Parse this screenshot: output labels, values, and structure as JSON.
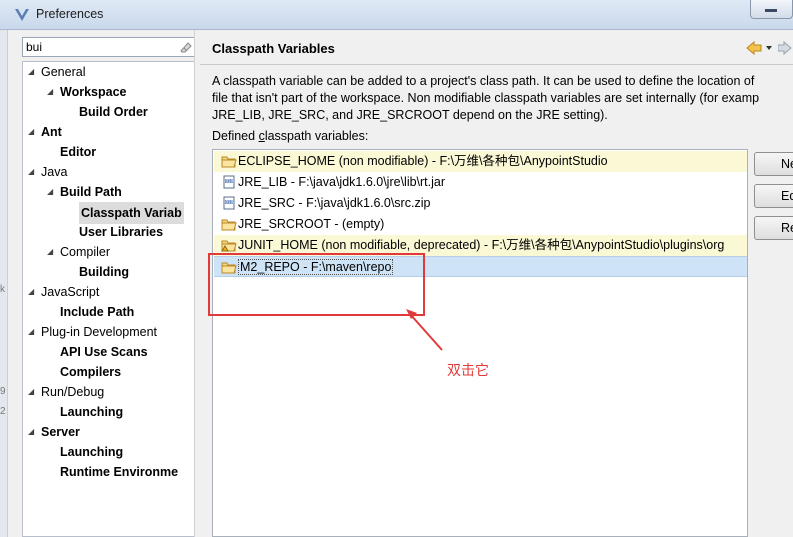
{
  "window": {
    "title": "Preferences"
  },
  "filter": {
    "value": "bui"
  },
  "tree": [
    {
      "label": "General",
      "level": 0,
      "expanded": true,
      "bold": false
    },
    {
      "label": "Workspace",
      "level": 1,
      "expanded": true,
      "bold": true
    },
    {
      "label": "Build Order",
      "level": 2,
      "bold": true
    },
    {
      "label": "Ant",
      "level": 0,
      "expanded": true,
      "bold": true
    },
    {
      "label": "Editor",
      "level": 1,
      "bold": true
    },
    {
      "label": "Java",
      "level": 0,
      "expanded": true,
      "bold": false
    },
    {
      "label": "Build Path",
      "level": 1,
      "expanded": true,
      "bold": true
    },
    {
      "label": "Classpath Variab",
      "level": 2,
      "bold": true,
      "selected": true
    },
    {
      "label": "User Libraries",
      "level": 2,
      "bold": true
    },
    {
      "label": "Compiler",
      "level": 1,
      "expanded": true,
      "bold": false
    },
    {
      "label": "Building",
      "level": 2,
      "bold": true
    },
    {
      "label": "JavaScript",
      "level": 0,
      "expanded": true,
      "bold": false
    },
    {
      "label": "Include Path",
      "level": 1,
      "bold": true
    },
    {
      "label": "Plug-in Development",
      "level": 0,
      "expanded": true,
      "bold": false
    },
    {
      "label": "API Use Scans",
      "level": 1,
      "bold": true
    },
    {
      "label": "Compilers",
      "level": 1,
      "bold": true
    },
    {
      "label": "Run/Debug",
      "level": 0,
      "expanded": true,
      "bold": false
    },
    {
      "label": "Launching",
      "level": 1,
      "bold": true
    },
    {
      "label": "Server",
      "level": 0,
      "expanded": true,
      "bold": true
    },
    {
      "label": "Launching",
      "level": 1,
      "bold": true
    },
    {
      "label": "Runtime Environme",
      "level": 1,
      "bold": true
    }
  ],
  "page": {
    "title": "Classpath Variables",
    "description": [
      "A classpath variable can be added to a project's class path. It can be used to define the location of",
      "file that isn't part of the workspace. Non modifiable classpath variables are set internally (for examp",
      "JRE_LIB, JRE_SRC, and JRE_SRCROOT depend on the JRE setting)."
    ],
    "defined_label_prefix": "Defined ",
    "defined_label_underlined": "c",
    "defined_label_suffix": "lasspath variables:"
  },
  "variables": [
    {
      "text": "ECLIPSE_HOME (non modifiable) - F:\\万维\\各种包\\AnypointStudio",
      "icon": "folder-icon",
      "state": "highlighted"
    },
    {
      "text": "JRE_LIB - F:\\java\\jdk1.6.0\\jre\\lib\\rt.jar",
      "icon": "jar-icon",
      "state": "normal"
    },
    {
      "text": "JRE_SRC - F:\\java\\jdk1.6.0\\src.zip",
      "icon": "jar-icon",
      "state": "normal"
    },
    {
      "text": "JRE_SRCROOT - (empty)",
      "icon": "folder-icon",
      "state": "normal"
    },
    {
      "text": "JUNIT_HOME (non modifiable, deprecated) - F:\\万维\\各种包\\AnypointStudio\\plugins\\org",
      "icon": "folder-warning-icon",
      "state": "highlighted"
    },
    {
      "text": "M2_REPO - F:\\maven\\repo",
      "icon": "folder-icon",
      "state": "selected"
    }
  ],
  "buttons": [
    {
      "label": "Ne",
      "name": "new-button"
    },
    {
      "label": "Ed",
      "name": "edit-button"
    },
    {
      "label": "Re",
      "name": "remove-button"
    }
  ],
  "annotation": {
    "text": "双击它",
    "color": "#e23a3a"
  },
  "colors": {
    "highlight_row": "#fbf8d6",
    "selected_row": "#cfe3f7",
    "annotation_red": "#e23a3a"
  }
}
